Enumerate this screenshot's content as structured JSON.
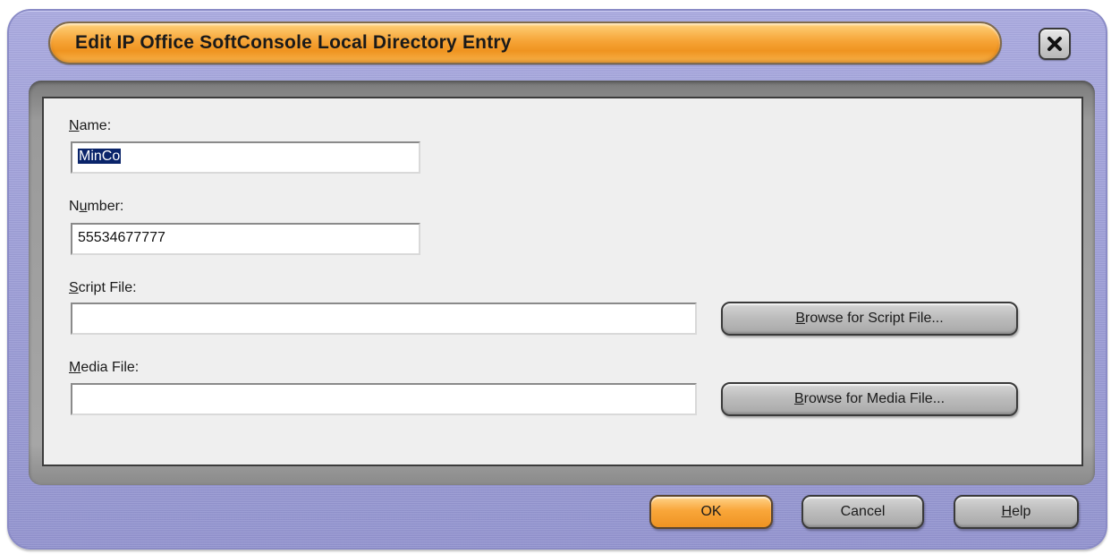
{
  "dialog": {
    "title": "Edit IP Office SoftConsole Local Directory Entry",
    "close_icon": "close-icon"
  },
  "form": {
    "name": {
      "label_accel": "N",
      "label_rest": "ame:",
      "value": "MinCo"
    },
    "number": {
      "label_pre": "N",
      "label_accel": "u",
      "label_rest": "mber:",
      "value": "55534677777"
    },
    "script_file": {
      "label_accel": "S",
      "label_rest": "cript File:",
      "value": ""
    },
    "media_file": {
      "label_accel": "M",
      "label_rest": "edia File:",
      "value": ""
    },
    "browse_script": {
      "accel": "B",
      "rest": "rowse for Script File..."
    },
    "browse_media": {
      "accel": "B",
      "rest": "rowse for Media File..."
    }
  },
  "footer": {
    "ok_label": "OK",
    "cancel_label": "Cancel",
    "help_accel": "H",
    "help_rest": "elp"
  },
  "colors": {
    "frame": "#9e9fd8",
    "title_accent": "#f6a437",
    "content_bg": "#efefef",
    "selection": "#0a246a"
  }
}
